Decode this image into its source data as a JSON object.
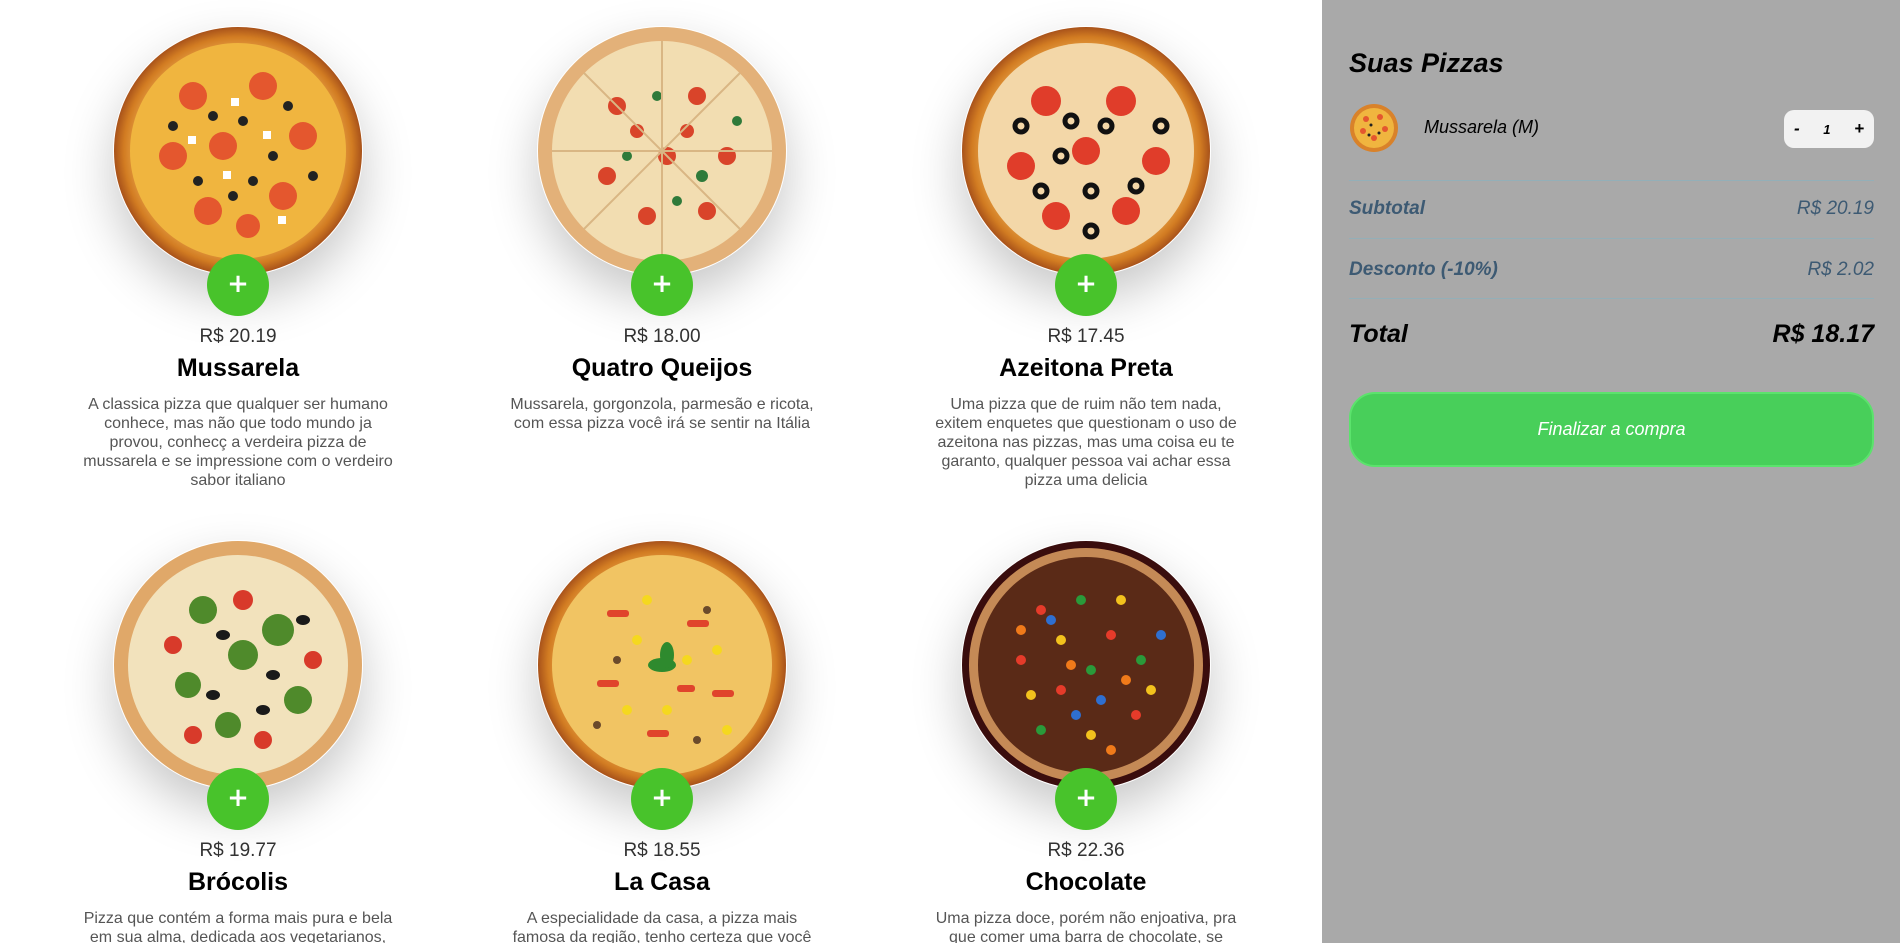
{
  "menu": {
    "add_label": "+",
    "pizzas": [
      {
        "name": "Mussarela",
        "price": "R$ 20.19",
        "description": "A classica pizza que qualquer ser humano conhece, mas não que todo mundo ja provou, conhecç a verdeira pizza de mussarela e se impressione com o verdeiro sabor italiano"
      },
      {
        "name": "Quatro Queijos",
        "price": "R$ 18.00",
        "description": "Mussarela, gorgonzola, parmesão e ricota, com essa pizza você irá se sentir na Itália"
      },
      {
        "name": "Azeitona Preta",
        "price": "R$ 17.45",
        "description": "Uma pizza que de ruim não tem nada, exitem enquetes que questionam o uso de azeitona nas pizzas, mas uma coisa eu te garanto, qualquer pessoa vai achar essa pizza uma delicia"
      },
      {
        "name": "Brócolis",
        "price": "R$ 19.77",
        "description": "Pizza que contém a forma mais pura e bela em sua alma, dedicada aos vegetarianos, ela é uma pizza que derrete"
      },
      {
        "name": "La Casa",
        "price": "R$ 18.55",
        "description": "A especialidade da casa, a pizza mais famosa da região, tenho certeza que você vai querer experimentar"
      },
      {
        "name": "Chocolate",
        "price": "R$ 22.36",
        "description": "Uma pizza doce, porém não enjoativa, pra que comer uma barra de chocolate, se você pode comer uma pizza?"
      }
    ]
  },
  "cart": {
    "title": "Suas Pizzas",
    "items": [
      {
        "name": "Mussarela (M)",
        "quantity": "1",
        "minus": "-",
        "plus": "+"
      }
    ],
    "subtotal_label": "Subtotal",
    "subtotal_value": "R$ 20.19",
    "discount_label": "Desconto (-10%)",
    "discount_value": "R$ 2.02",
    "total_label": "Total",
    "total_value": "R$ 18.17",
    "checkout_label": "Finalizar a compra"
  },
  "colors": {
    "add_button": "#48c32b",
    "cart_background": "#a9a9a9",
    "checkout_button": "#48cf5a",
    "summary_text": "#3d5a73"
  }
}
